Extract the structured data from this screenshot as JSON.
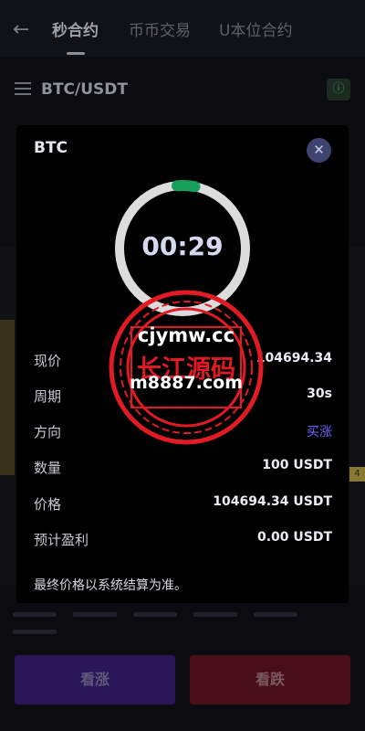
{
  "header": {
    "back_icon": "arrow-left-icon",
    "tabs": [
      {
        "label": "秒合约",
        "active": true
      },
      {
        "label": "币币交易",
        "active": false
      },
      {
        "label": "U本位合约",
        "active": false
      }
    ]
  },
  "pair_bar": {
    "menu_icon": "hamburger-menu-icon",
    "pair": "BTC/USDT",
    "info_icon": "info-icon"
  },
  "chart": {
    "y_tag": "4"
  },
  "actions": {
    "up_label": "看涨",
    "down_label": "看跌",
    "up_color": "#2a1658",
    "down_color": "#4a0e1a"
  },
  "modal": {
    "title": "BTC",
    "close_icon": "close-icon",
    "countdown": "00:29",
    "progress_ring_color": "#16a05a",
    "rows": [
      {
        "key": "现价",
        "value": "104694.34"
      },
      {
        "key": "周期",
        "value": "30s"
      },
      {
        "key": "方向",
        "value": "买涨",
        "color": "#7a5cff"
      },
      {
        "key": "数量",
        "value": "100 USDT"
      },
      {
        "key": "价格",
        "value": "104694.34 USDT"
      },
      {
        "key": "预计盈利",
        "value": "0.00 USDT"
      }
    ],
    "note": "最终价格以系统结算为准。"
  },
  "watermark": {
    "line1": "cjymw.cc",
    "line2": "长江源码",
    "line3": "m8887.com",
    "color": "#e11b24"
  }
}
